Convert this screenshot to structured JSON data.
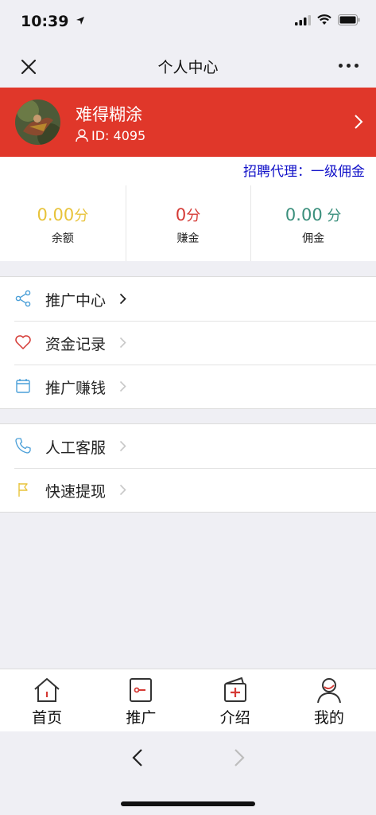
{
  "status": {
    "time": "10:39"
  },
  "nav": {
    "title": "个人中心"
  },
  "profile": {
    "name": "难得糊涂",
    "id_text": "ID: 4095"
  },
  "marquee": {
    "text": "招聘代理：一级佣金"
  },
  "stats": [
    {
      "value": "0.00",
      "unit": "分",
      "label": "余额",
      "color": "#e8c33a"
    },
    {
      "value": "0",
      "unit": "分",
      "label": "赚金",
      "color": "#d53a35"
    },
    {
      "value": "0.00",
      "unit": " 分",
      "label": "佣金",
      "color": "#3a8f7c"
    }
  ],
  "menu_group_1": [
    {
      "label": "推广中心",
      "icon": "share-icon"
    },
    {
      "label": "资金记录",
      "icon": "heart-icon"
    },
    {
      "label": "推广赚钱",
      "icon": "calendar-icon"
    }
  ],
  "menu_group_2": [
    {
      "label": "人工客服",
      "icon": "phone-icon"
    },
    {
      "label": "快速提现",
      "icon": "flag-icon"
    }
  ],
  "tabs": [
    {
      "label": "首页",
      "icon": "home-icon"
    },
    {
      "label": "推广",
      "icon": "promote-icon"
    },
    {
      "label": "介绍",
      "icon": "intro-icon"
    },
    {
      "label": "我的",
      "icon": "user-icon"
    }
  ],
  "colors": {
    "header_red": "#e0372a",
    "marquee_blue": "#1010c8"
  }
}
